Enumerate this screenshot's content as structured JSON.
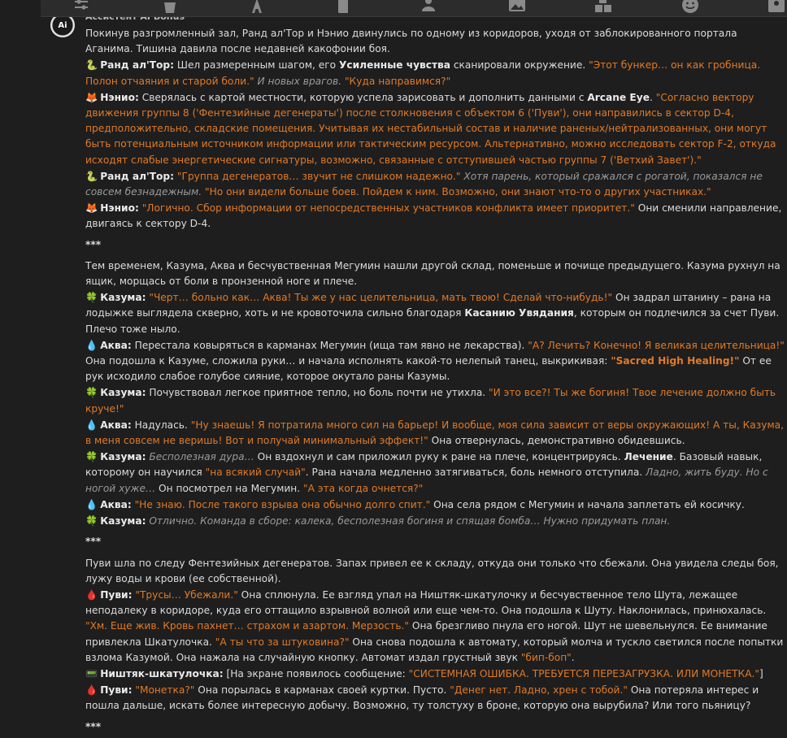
{
  "toolbar": {
    "icons": [
      "sliders-icon",
      "bucket-icon",
      "text-icon",
      "book-icon",
      "user-gear-icon",
      "image-icon",
      "blocks-icon",
      "smile-icon",
      "profile-icon"
    ]
  },
  "post": {
    "author_stub": "Ассистент AI Bonus"
  },
  "colors": {
    "quote": "#e07a27",
    "thought": "#9a9a9a",
    "background": "#1e1e1e"
  },
  "paragraphs": [
    {
      "kind": "narr",
      "segments": [
        {
          "t": "n",
          "text": "Покинув разгромленный зал, Ранд ал'Тор и Нэнио двинулись по одному из коридоров, уходя от заблокированного портала Аганима. Тишина давила после недавней какофонии боя."
        }
      ]
    },
    {
      "kind": "line",
      "emoji": "🐍",
      "segments": [
        {
          "t": "sp",
          "text": "Ранд ал'Тор:"
        },
        {
          "t": "n",
          "text": " Шел размеренным шагом, его "
        },
        {
          "t": "b",
          "text": "Усиленные чувства"
        },
        {
          "t": "n",
          "text": " сканировали окружение. "
        },
        {
          "t": "q",
          "text": "\"Этот бункер… он как гробница. Полон отчаяния и старой боли.\""
        },
        {
          "t": "th",
          "text": " И новых врагов."
        },
        {
          "t": "q",
          "text": " \"Куда направимся?\""
        }
      ]
    },
    {
      "kind": "line",
      "emoji": "🦊",
      "segments": [
        {
          "t": "sp",
          "text": "Нэнио:"
        },
        {
          "t": "n",
          "text": " Сверялась с картой местности, которую успела зарисовать и дополнить данными с "
        },
        {
          "t": "b",
          "text": "Arcane Eye"
        },
        {
          "t": "n",
          "text": ". "
        },
        {
          "t": "q",
          "text": "\"Согласно вектору движения группы 8 ('Фентезийные дегенераты') после столкновения с объектом 6 ('Пуви'), они направились в сектор D-4, предположительно, складские помещения. Учитывая их нестабильный состав и наличие раненых/нейтрализованных, они могут быть потенциальным источником информации или тактическим ресурсом. Альтернативно, можно исследовать сектор F-2, откуда исходят слабые энергетические сигнатуры, возможно, связанные с отступившей частью группы 7 ('Ветхий Завет').\""
        }
      ]
    },
    {
      "kind": "line",
      "emoji": "🐍",
      "segments": [
        {
          "t": "sp",
          "text": "Ранд ал'Тор:"
        },
        {
          "t": "q",
          "text": " \"Группа дегенератов… звучит не слишком надежно.\""
        },
        {
          "t": "th",
          "text": " Хотя парень, который сражался с рогатой, показался не совсем безнадежным."
        },
        {
          "t": "q",
          "text": " \"Но они видели больше боев. Пойдем к ним. Возможно, они знают что-то о других участниках.\""
        }
      ]
    },
    {
      "kind": "line",
      "emoji": "🦊",
      "segments": [
        {
          "t": "sp",
          "text": "Нэнио:"
        },
        {
          "t": "q",
          "text": " \"Логично. Сбор информации от непосредственных участников конфликта имеет приоритет.\""
        },
        {
          "t": "n",
          "text": " Они сменили направление, двигаясь к сектору D-4."
        }
      ]
    },
    {
      "kind": "sep",
      "text": "***"
    },
    {
      "kind": "narr",
      "segments": [
        {
          "t": "n",
          "text": "Тем временем, Казума, Аква и бесчувственная Мегумин нашли другой склад, поменьше и почище предыдущего. Казума рухнул на ящик, морщась от боли в пронзенной ноге и плече."
        }
      ]
    },
    {
      "kind": "line",
      "emoji": "🍀",
      "segments": [
        {
          "t": "sp",
          "text": "Казума:"
        },
        {
          "t": "q",
          "text": " \"Черт… больно как… Аква! Ты же у нас целительница, мать твою! Сделай что-нибудь!\""
        },
        {
          "t": "n",
          "text": " Он задрал штанину – рана на лодыжке выглядела скверно, хоть и не кровоточила сильно благодаря "
        },
        {
          "t": "b",
          "text": "Касанию Увядания"
        },
        {
          "t": "n",
          "text": ", которым он подлечился за счет Пуви. Плечо тоже ныло."
        }
      ]
    },
    {
      "kind": "line",
      "emoji": "💧",
      "segments": [
        {
          "t": "sp",
          "text": "Аква:"
        },
        {
          "t": "n",
          "text": " Перестала ковыряться в карманах Мегумин (ища там явно не лекарства). "
        },
        {
          "t": "q",
          "text": "\"А? Лечить? Конечно! Я великая целительница!\""
        },
        {
          "t": "n",
          "text": " Она подошла к Казуме, сложила руки… и начала исполнять какой-то нелепый танец, выкрикивая: "
        },
        {
          "t": "qb",
          "text": "\"Sacred High Healing!\""
        },
        {
          "t": "n",
          "text": " От ее рук исходило слабое голубое сияние, которое окутало раны Казумы."
        }
      ]
    },
    {
      "kind": "line",
      "emoji": "🍀",
      "segments": [
        {
          "t": "sp",
          "text": "Казума:"
        },
        {
          "t": "n",
          "text": " Почувствовал легкое приятное тепло, но боль почти не утихла. "
        },
        {
          "t": "q",
          "text": "\"И это все?! Ты же богиня! Твое лечение должно быть круче!\""
        }
      ]
    },
    {
      "kind": "line",
      "emoji": "💧",
      "segments": [
        {
          "t": "sp",
          "text": "Аква:"
        },
        {
          "t": "n",
          "text": " Надулась. "
        },
        {
          "t": "q",
          "text": "\"Ну знаешь! Я потратила много сил на барьер! И вообще, моя сила зависит от веры окружающих! А ты, Казума, в меня совсем не веришь! Вот и получай минимальный эффект!\""
        },
        {
          "t": "n",
          "text": " Она отвернулась, демонстративно обидевшись."
        }
      ]
    },
    {
      "kind": "line",
      "emoji": "🍀",
      "segments": [
        {
          "t": "sp",
          "text": "Казума:"
        },
        {
          "t": "th",
          "text": " Бесполезная дура…"
        },
        {
          "t": "n",
          "text": " Он вздохнул и сам приложил руку к ране на плече, концентрируясь. "
        },
        {
          "t": "b",
          "text": "Лечение"
        },
        {
          "t": "n",
          "text": ". Базовый навык, которому он научился "
        },
        {
          "t": "q",
          "text": "\"на всякий случай\""
        },
        {
          "t": "n",
          "text": ". Рана начала медленно затягиваться, боль немного отступила. "
        },
        {
          "t": "th",
          "text": "Ладно, жить буду. Но с ногой хуже…"
        },
        {
          "t": "n",
          "text": " Он посмотрел на Мегумин. "
        },
        {
          "t": "q",
          "text": "\"А эта когда очнется?\""
        }
      ]
    },
    {
      "kind": "line",
      "emoji": "💧",
      "segments": [
        {
          "t": "sp",
          "text": "Аква:"
        },
        {
          "t": "q",
          "text": " \"Не знаю. После такого взрыва она обычно долго спит.\""
        },
        {
          "t": "n",
          "text": " Она села рядом с Мегумин и начала заплетать ей косичку."
        }
      ]
    },
    {
      "kind": "line",
      "emoji": "🍀",
      "segments": [
        {
          "t": "sp",
          "text": "Казума:"
        },
        {
          "t": "th",
          "text": " Отлично. Команда в сборе: калека, бесполезная богиня и спящая бомба… Нужно придумать план."
        }
      ]
    },
    {
      "kind": "sep",
      "text": "***"
    },
    {
      "kind": "narr",
      "segments": [
        {
          "t": "n",
          "text": "Пуви шла по следу Фентезийных дегенератов. Запах привел ее к складу, откуда они только что сбежали. Она увидела следы боя, лужу воды и крови (ее собственной)."
        }
      ]
    },
    {
      "kind": "line",
      "emoji": "🩸",
      "segments": [
        {
          "t": "sp",
          "text": "Пуви:"
        },
        {
          "t": "q",
          "text": " \"Трусы… Убежали.\""
        },
        {
          "t": "n",
          "text": " Она сплюнула. Ее взгляд упал на Ништяк-шкатулочку и бесчувственное тело Шута, лежащее неподалеку в коридоре, куда его оттащило взрывной волной или еще чем-то. Она подошла к Шуту. Наклонилась, принюхалась. "
        },
        {
          "t": "q",
          "text": "\"Хм. Еще жив. Кровь пахнет… страхом и азартом. Мерзость.\""
        },
        {
          "t": "n",
          "text": " Она брезгливо пнула его ногой. Шут не шевельнулся. Ее внимание привлекла Шкатулочка. "
        },
        {
          "t": "q",
          "text": "\"А ты что за штуковина?\""
        },
        {
          "t": "n",
          "text": " Она снова подошла к автомату, который молча и тускло светился после попытки взлома Казумой. Она нажала на случайную кнопку. Автомат издал грустный звук "
        },
        {
          "t": "q",
          "text": "\"бип-боп\""
        },
        {
          "t": "n",
          "text": "."
        }
      ]
    },
    {
      "kind": "line",
      "emoji": "📟",
      "segments": [
        {
          "t": "sp",
          "text": "Ништяк-шкатулочка:"
        },
        {
          "t": "n",
          "text": " [На экране появилось сообщение: "
        },
        {
          "t": "q",
          "text": "\"СИСТЕМНАЯ ОШИБКА. ТРЕБУЕТСЯ ПЕРЕЗАГРУЗКА. ИЛИ МОНЕТКА.\""
        },
        {
          "t": "n",
          "text": "]"
        }
      ]
    },
    {
      "kind": "line",
      "emoji": "🩸",
      "segments": [
        {
          "t": "sp",
          "text": "Пуви:"
        },
        {
          "t": "q",
          "text": " \"Монетка?\""
        },
        {
          "t": "n",
          "text": " Она порылась в карманах своей куртки. Пусто. "
        },
        {
          "t": "q",
          "text": "\"Денег нет. Ладно, хрен с тобой.\""
        },
        {
          "t": "n",
          "text": " Она потеряла интерес и пошла дальше, искать более интересную добычу. Возможно, ту толстуху в броне, которую она вырубила? Или того пьяницу?"
        }
      ]
    },
    {
      "kind": "sep",
      "text": "***"
    }
  ]
}
